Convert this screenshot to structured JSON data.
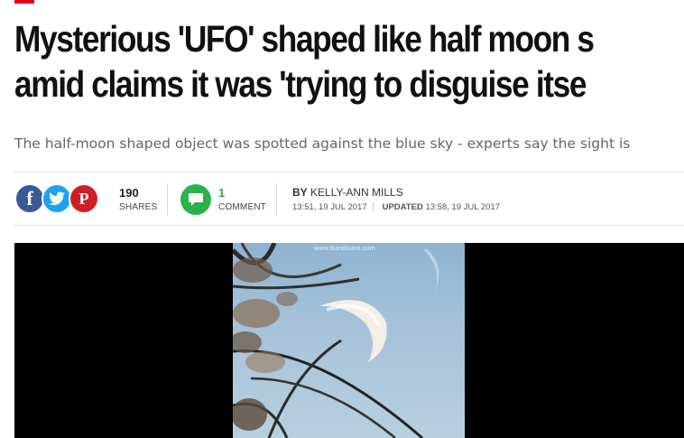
{
  "headline": {
    "line1": "Mysterious 'UFO' shaped like half moon s",
    "line2": "amid claims it was 'trying to disguise itse"
  },
  "standfirst": "The half-moon shaped object was spotted against the blue sky - experts say the sight is",
  "share": {
    "count": "190",
    "count_label": "SHARES",
    "icons": [
      "facebook-icon",
      "twitter-icon",
      "pinterest-icon"
    ]
  },
  "comments": {
    "count": "1",
    "label": "COMMENT"
  },
  "byline": {
    "prefix": "BY",
    "author": "KELLY-ANN MILLS",
    "published": "13:51, 19 JUL 2017",
    "updated_label": "UPDATED",
    "updated": "13:58, 19 JUL 2017"
  },
  "video": {
    "watermark": "www.Bandicam.com"
  },
  "colors": {
    "brand_red": "#e2001a",
    "facebook": "#3b5998",
    "twitter": "#1da1f2",
    "pinterest": "#cb2027",
    "comment_green": "#2bb24c"
  }
}
